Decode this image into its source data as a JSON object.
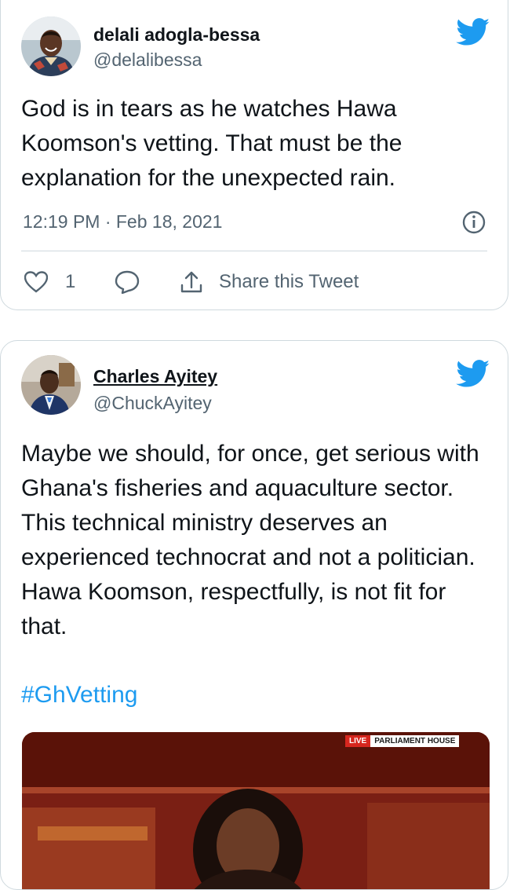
{
  "tweets": [
    {
      "author": "delali adogla-bessa",
      "handle": "@delalibessa",
      "text": "God is in tears as he watches Hawa Koomson's vetting. That must be the explanation for the unexpected rain.",
      "timestamp": "12:19 PM · Feb 18, 2021",
      "likes": "1",
      "share_label": "Share this Tweet"
    },
    {
      "author": "Charles Ayitey",
      "handle": "@ChuckAyitey",
      "text": "Maybe we should, for once, get serious with Ghana's fisheries and aquaculture sector. This technical ministry deserves an experienced technocrat and not a politician. Hawa Koomson, respectfully, is not fit for that.",
      "hashtag": "#GhVetting",
      "media_badge": {
        "live": "LIVE",
        "location": "PARLIAMENT HOUSE"
      }
    }
  ],
  "colors": {
    "twitter_blue": "#1d9bf0",
    "text_primary": "#0f1419",
    "text_secondary": "#536471",
    "border": "#cfd9de",
    "live_red": "#d7261e"
  }
}
